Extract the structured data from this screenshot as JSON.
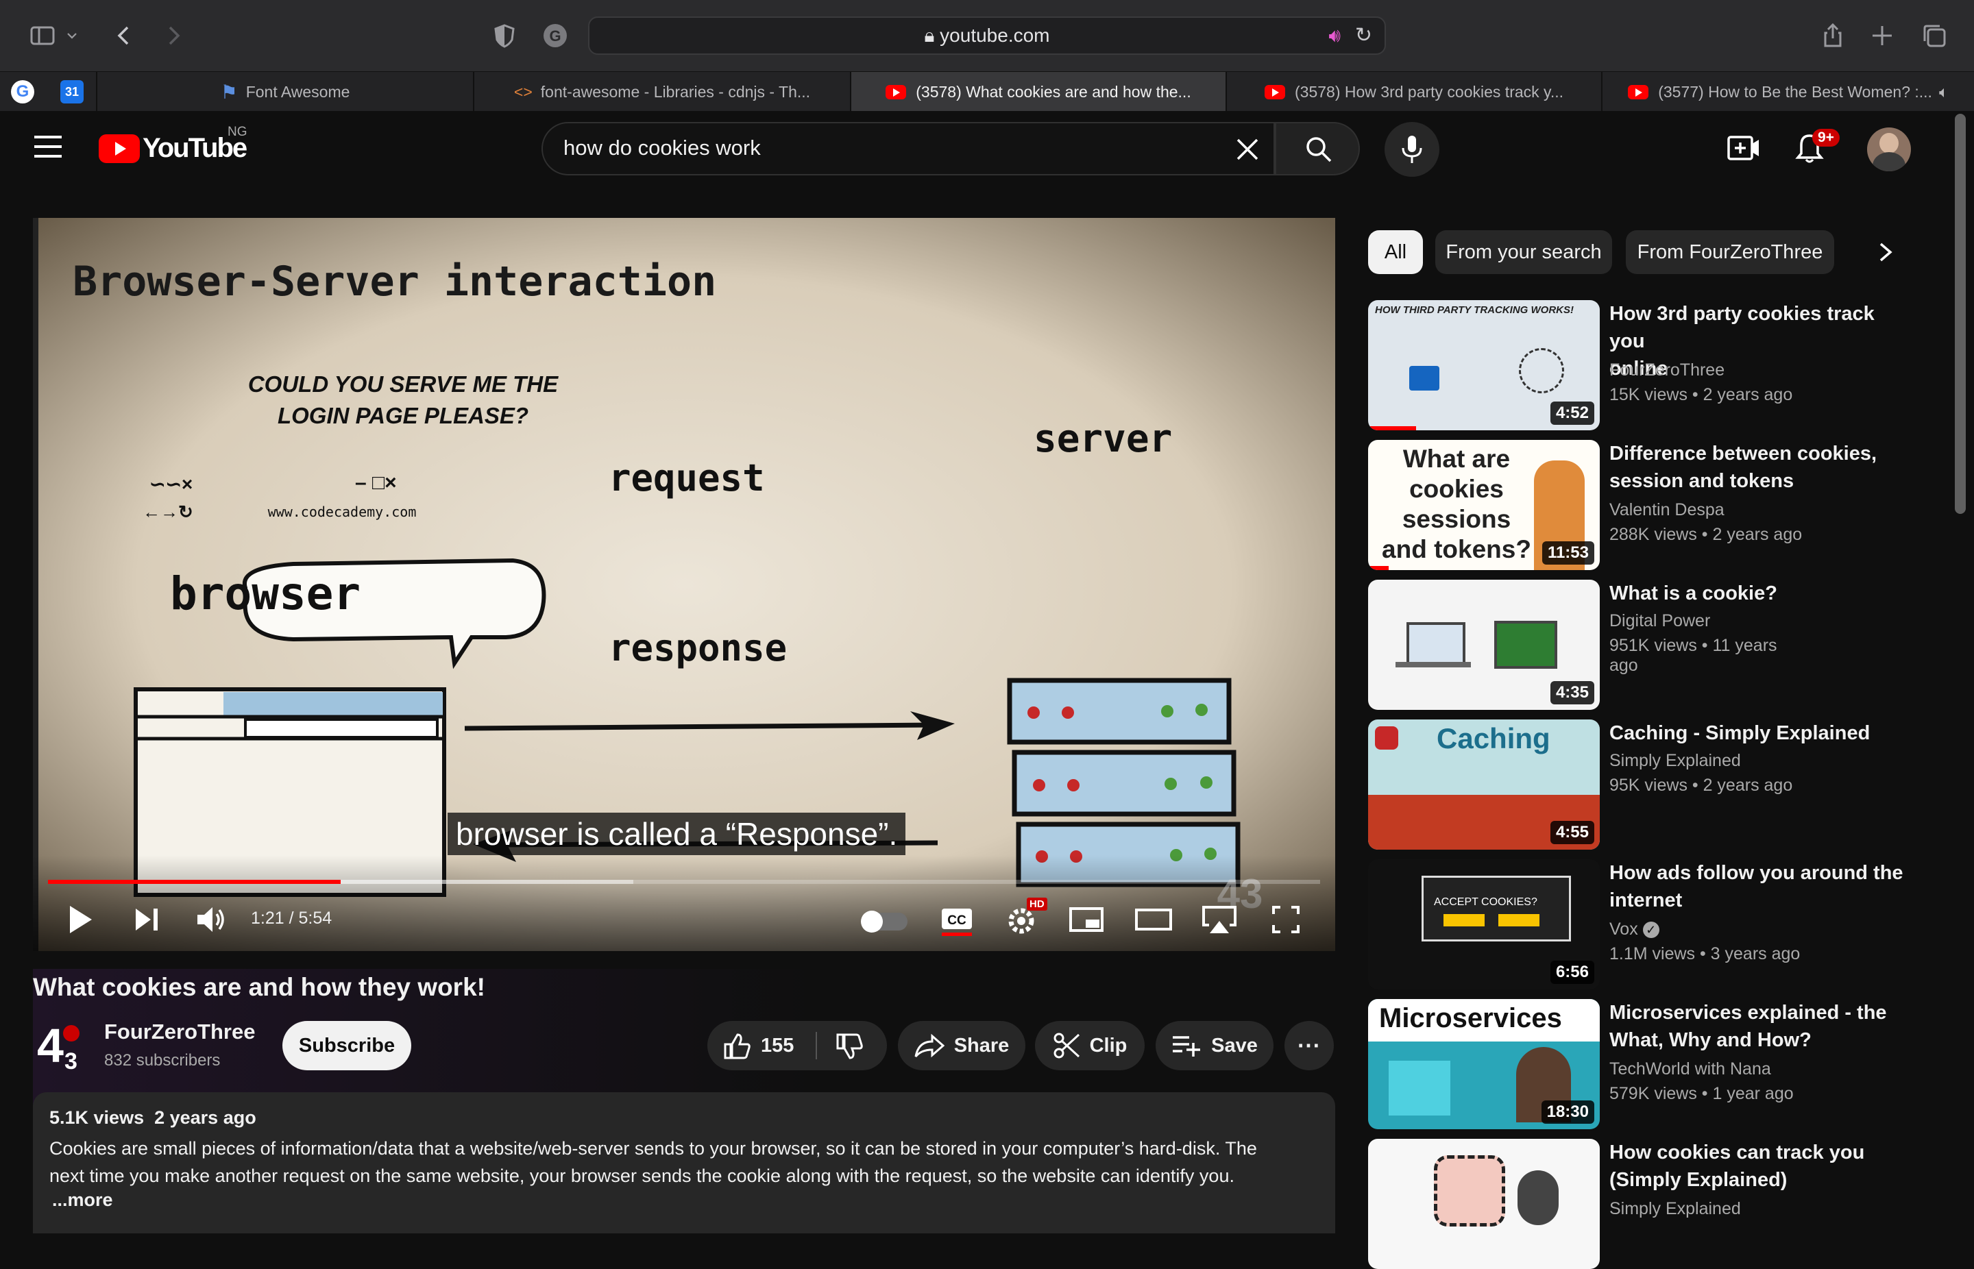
{
  "browser": {
    "url": "youtube.com",
    "tabs": [
      {
        "label": "Font Awesome"
      },
      {
        "label": "font-awesome - Libraries - cdnjs - Th..."
      },
      {
        "label": "(3578) What cookies are and how the..."
      },
      {
        "label": "(3578) How 3rd party cookies track y..."
      },
      {
        "label": "(3577) How to Be the Best Women? :..."
      }
    ]
  },
  "header": {
    "logo_text": "YouTube",
    "country": "NG",
    "search_value": "how do cookies work",
    "notifications": "9+"
  },
  "player": {
    "slide_title": "Browser-Server interaction",
    "speech": [
      "COULD YOU SERVE ME THE",
      "LOGIN PAGE PLEASE?"
    ],
    "browser_url": "www.codecademy.com",
    "browser_label": "browser",
    "server_label": "server",
    "request_label": "request",
    "response_label": "response",
    "caption": "browser is called a “Response”.",
    "time": "1:21 / 5:54",
    "progress_played": 0.23,
    "progress_buffered": 0.46,
    "hd_badge": "HD"
  },
  "video": {
    "title": "What cookies are and how they work!",
    "channel": "FourZeroThree",
    "subscribers": "832 subscribers",
    "subscribe_label": "Subscribe",
    "likes": "155",
    "share_label": "Share",
    "clip_label": "Clip",
    "save_label": "Save",
    "views": "5.1K views",
    "age": "2 years ago",
    "description_1": "Cookies are small pieces of information/data that a website/web-server sends to your browser, so it can be stored in your computer’s hard-disk. The",
    "description_2": "next time you make another request on the same website, your browser sends the cookie along with the request, so the website can identify you.",
    "more_label": "...more"
  },
  "sidebar": {
    "chips": [
      "All",
      "From your search",
      "From FourZeroThree"
    ],
    "videos": [
      {
        "title_1": "How 3rd party cookies track you",
        "title_2": "online",
        "channel": "FourZeroThree",
        "meta": "15K views • 2 years ago",
        "duration": "4:52",
        "thumb_text": "HOW THIRD PARTY TRACKING WORKS!"
      },
      {
        "title_1": "Difference between cookies,",
        "title_2": "session and tokens",
        "channel": "Valentin Despa",
        "meta": "288K views • 2 years ago",
        "duration": "11:53",
        "thumb_text": "What are cookies sessions and tokens?"
      },
      {
        "title_1": "What is a cookie?",
        "title_2": "",
        "channel": "Digital Power",
        "meta": "951K views • 11 years ago",
        "duration": "4:35",
        "thumb_text": ""
      },
      {
        "title_1": "Caching - Simply Explained",
        "title_2": "",
        "channel": "Simply Explained",
        "meta": "95K views • 2 years ago",
        "duration": "4:55",
        "thumb_text": "Caching"
      },
      {
        "title_1": "How ads follow you around the",
        "title_2": "internet",
        "channel": "Vox",
        "meta": "1.1M views • 3 years ago",
        "duration": "6:56",
        "thumb_text": "ACCEPT COOKIES?"
      },
      {
        "title_1": "Microservices explained - the",
        "title_2": "What, Why and How?",
        "channel": "TechWorld with Nana",
        "meta": "579K views • 1 year ago",
        "duration": "18:30",
        "thumb_text": "Microservices"
      },
      {
        "title_1": "How cookies can track you",
        "title_2": "(Simply Explained)",
        "channel": "Simply Explained",
        "meta": "",
        "duration": "",
        "thumb_text": ""
      }
    ]
  }
}
